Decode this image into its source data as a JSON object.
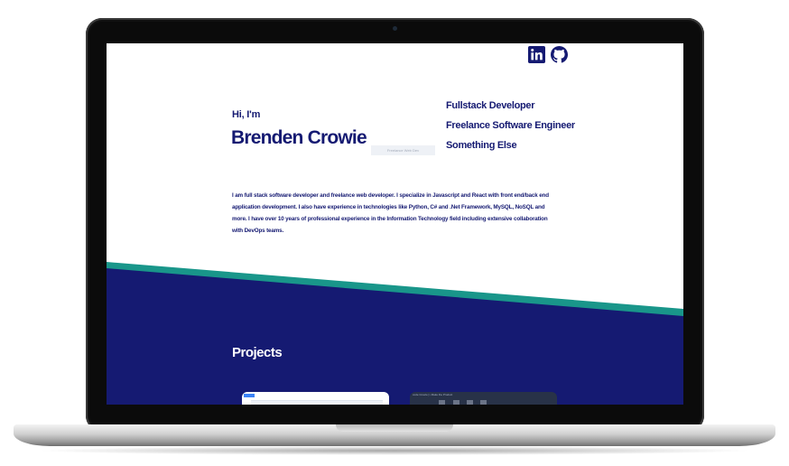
{
  "colors": {
    "primary": "#151a72",
    "accent_stripe": "#19968a",
    "screen_bg": "#ffffff",
    "laptop_bezel": "#0b0b0b"
  },
  "header": {
    "social": [
      {
        "icon": "linkedin-icon",
        "label": "LinkedIn"
      },
      {
        "icon": "github-icon",
        "label": "GitHub"
      }
    ]
  },
  "hero": {
    "greeting": "Hi, I'm",
    "name": "Brenden Crowie",
    "faint_label": "Freelance Web Dev",
    "roles": [
      "Fullstack Developer",
      "Freelance Software Engineer",
      "Something Else"
    ],
    "bio": "I am full stack software developer and freelance web developer. I specialize in Javascript and React with front end/back end application development. I also have experience in technologies like Python, C# and .Net Framework, MySQL, NoSQL and more. I have over 10 years of professional experience in the Information Technology field including extensive collaboration with DevOps teams."
  },
  "projects": {
    "heading": "Projects",
    "cards": [
      {
        "theme": "light"
      },
      {
        "theme": "dark",
        "label": "code  Crowie  ▷\nMake the Product"
      }
    ]
  }
}
